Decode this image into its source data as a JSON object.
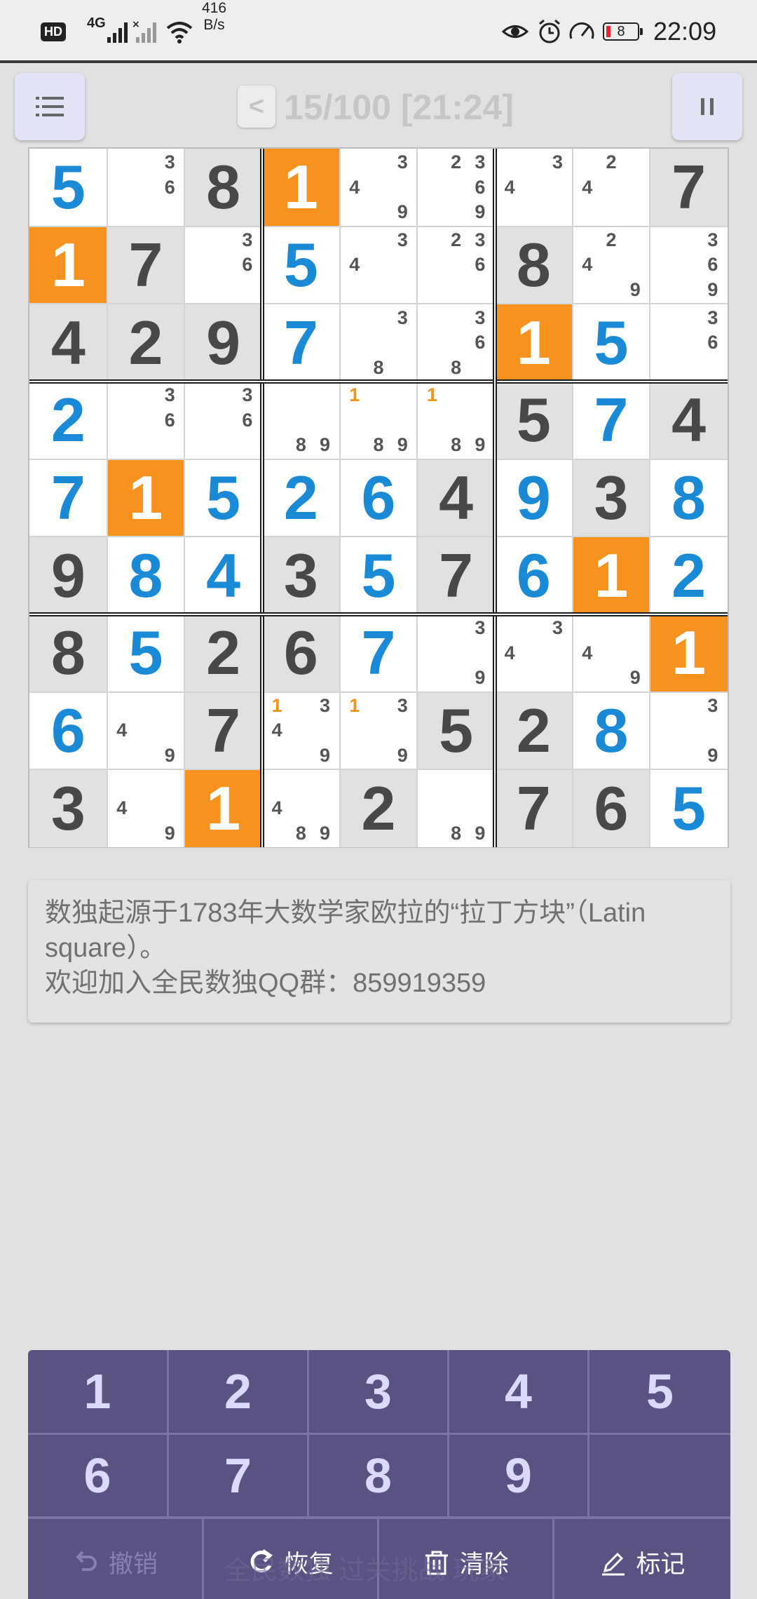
{
  "status_bar": {
    "hd_label": "HD",
    "signal_label": "4G",
    "net_speed_value": "416",
    "net_speed_unit": "B/s",
    "battery_level": "8",
    "time": "22:09"
  },
  "header": {
    "back_label": "<",
    "level_progress": "15/100 [21:24]",
    "menu_icon": "list-icon",
    "pause_icon": "pause-icon"
  },
  "board": {
    "rows": [
      [
        {
          "v": "5",
          "t": "user",
          "bg": "white"
        },
        {
          "n": [
            "3",
            "6"
          ],
          "bg": "white"
        },
        {
          "v": "8",
          "t": "given",
          "bg": "grey"
        },
        {
          "v": "1",
          "t": "hl",
          "bg": "orange"
        },
        {
          "n": [
            "3",
            "4",
            "9"
          ],
          "bg": "white"
        },
        {
          "n": [
            "2",
            "3",
            "6",
            "9"
          ],
          "bg": "white"
        },
        {
          "n": [
            "3",
            "4"
          ],
          "bg": "white"
        },
        {
          "n": [
            "2",
            "4"
          ],
          "bg": "white"
        },
        {
          "v": "7",
          "t": "given",
          "bg": "grey"
        }
      ],
      [
        {
          "v": "1",
          "t": "hl",
          "bg": "orange"
        },
        {
          "v": "7",
          "t": "given",
          "bg": "grey"
        },
        {
          "n": [
            "3",
            "6"
          ],
          "bg": "white"
        },
        {
          "v": "5",
          "t": "user",
          "bg": "white"
        },
        {
          "n": [
            "3",
            "4"
          ],
          "bg": "white"
        },
        {
          "n": [
            "2",
            "3",
            "6"
          ],
          "bg": "white"
        },
        {
          "v": "8",
          "t": "given",
          "bg": "grey"
        },
        {
          "n": [
            "2",
            "4",
            "9"
          ],
          "bg": "white"
        },
        {
          "n": [
            "3",
            "6",
            "9"
          ],
          "bg": "white"
        }
      ],
      [
        {
          "v": "4",
          "t": "given",
          "bg": "grey"
        },
        {
          "v": "2",
          "t": "given",
          "bg": "grey"
        },
        {
          "v": "9",
          "t": "given",
          "bg": "grey"
        },
        {
          "v": "7",
          "t": "user",
          "bg": "white"
        },
        {
          "n": [
            "3",
            "8"
          ],
          "bg": "white"
        },
        {
          "n": [
            "3",
            "6",
            "8"
          ],
          "bg": "white"
        },
        {
          "v": "1",
          "t": "hl",
          "bg": "orange"
        },
        {
          "v": "5",
          "t": "user",
          "bg": "white"
        },
        {
          "n": [
            "3",
            "6"
          ],
          "bg": "white"
        }
      ],
      [
        {
          "v": "2",
          "t": "user",
          "bg": "white"
        },
        {
          "n": [
            "3",
            "6"
          ],
          "bg": "white"
        },
        {
          "n": [
            "3",
            "6"
          ],
          "bg": "white"
        },
        {
          "n": [
            "8",
            "9"
          ],
          "bg": "white"
        },
        {
          "n": [
            "1",
            "8",
            "9"
          ],
          "bg": "white"
        },
        {
          "n": [
            "1",
            "8",
            "9"
          ],
          "bg": "white"
        },
        {
          "v": "5",
          "t": "given",
          "bg": "grey"
        },
        {
          "v": "7",
          "t": "user",
          "bg": "white"
        },
        {
          "v": "4",
          "t": "given",
          "bg": "grey"
        }
      ],
      [
        {
          "v": "7",
          "t": "user",
          "bg": "white"
        },
        {
          "v": "1",
          "t": "hl",
          "bg": "orange"
        },
        {
          "v": "5",
          "t": "user",
          "bg": "white"
        },
        {
          "v": "2",
          "t": "user",
          "bg": "white"
        },
        {
          "v": "6",
          "t": "user",
          "bg": "white"
        },
        {
          "v": "4",
          "t": "given",
          "bg": "grey"
        },
        {
          "v": "9",
          "t": "user",
          "bg": "white"
        },
        {
          "v": "3",
          "t": "given",
          "bg": "grey"
        },
        {
          "v": "8",
          "t": "user",
          "bg": "white"
        }
      ],
      [
        {
          "v": "9",
          "t": "given",
          "bg": "grey"
        },
        {
          "v": "8",
          "t": "user",
          "bg": "white"
        },
        {
          "v": "4",
          "t": "user",
          "bg": "white"
        },
        {
          "v": "3",
          "t": "given",
          "bg": "grey"
        },
        {
          "v": "5",
          "t": "user",
          "bg": "white"
        },
        {
          "v": "7",
          "t": "given",
          "bg": "grey"
        },
        {
          "v": "6",
          "t": "user",
          "bg": "white"
        },
        {
          "v": "1",
          "t": "hl",
          "bg": "orange"
        },
        {
          "v": "2",
          "t": "user",
          "bg": "white"
        }
      ],
      [
        {
          "v": "8",
          "t": "given",
          "bg": "grey"
        },
        {
          "v": "5",
          "t": "user",
          "bg": "white"
        },
        {
          "v": "2",
          "t": "given",
          "bg": "grey"
        },
        {
          "v": "6",
          "t": "given",
          "bg": "grey"
        },
        {
          "v": "7",
          "t": "user",
          "bg": "white"
        },
        {
          "n": [
            "3",
            "9"
          ],
          "bg": "white"
        },
        {
          "n": [
            "3",
            "4"
          ],
          "bg": "white"
        },
        {
          "n": [
            "4",
            "9"
          ],
          "bg": "white"
        },
        {
          "v": "1",
          "t": "hl",
          "bg": "orange"
        }
      ],
      [
        {
          "v": "6",
          "t": "user",
          "bg": "white"
        },
        {
          "n": [
            "4",
            "9"
          ],
          "bg": "white"
        },
        {
          "v": "7",
          "t": "given",
          "bg": "grey"
        },
        {
          "n": [
            "1",
            "3",
            "4",
            "9"
          ],
          "bg": "white"
        },
        {
          "n": [
            "1",
            "3",
            "9"
          ],
          "bg": "white"
        },
        {
          "v": "5",
          "t": "given",
          "bg": "grey"
        },
        {
          "v": "2",
          "t": "given",
          "bg": "grey"
        },
        {
          "v": "8",
          "t": "user",
          "bg": "white"
        },
        {
          "n": [
            "3",
            "9"
          ],
          "bg": "white"
        }
      ],
      [
        {
          "v": "3",
          "t": "given",
          "bg": "grey"
        },
        {
          "n": [
            "4",
            "9"
          ],
          "bg": "white"
        },
        {
          "v": "1",
          "t": "hl",
          "bg": "orange"
        },
        {
          "n": [
            "4",
            "8",
            "9"
          ],
          "bg": "white"
        },
        {
          "v": "2",
          "t": "given",
          "bg": "grey"
        },
        {
          "n": [
            "8",
            "9"
          ],
          "bg": "white"
        },
        {
          "v": "7",
          "t": "given",
          "bg": "grey"
        },
        {
          "v": "6",
          "t": "given",
          "bg": "grey"
        },
        {
          "v": "5",
          "t": "user",
          "bg": "white"
        }
      ]
    ],
    "highlight_note": "1",
    "colors": {
      "user_digit": "#1a8ad6",
      "given_digit": "#484848",
      "highlight_bg": "#f7921e",
      "highlight_note": "#f39415"
    }
  },
  "tip": {
    "line1": "数独起源于1783年大数学家欧拉的“拉丁方块”（Latin square）。",
    "line2": "欢迎加入全民数独QQ群：859919359"
  },
  "keypad": {
    "digits": [
      "1",
      "2",
      "3",
      "4",
      "5",
      "6",
      "7",
      "8",
      "9"
    ],
    "undo_label": "撤销",
    "redo_label": "恢复",
    "clear_label": "清除",
    "mark_label": "标记",
    "footer_text": "全民数独 过关挑战 玩家"
  }
}
